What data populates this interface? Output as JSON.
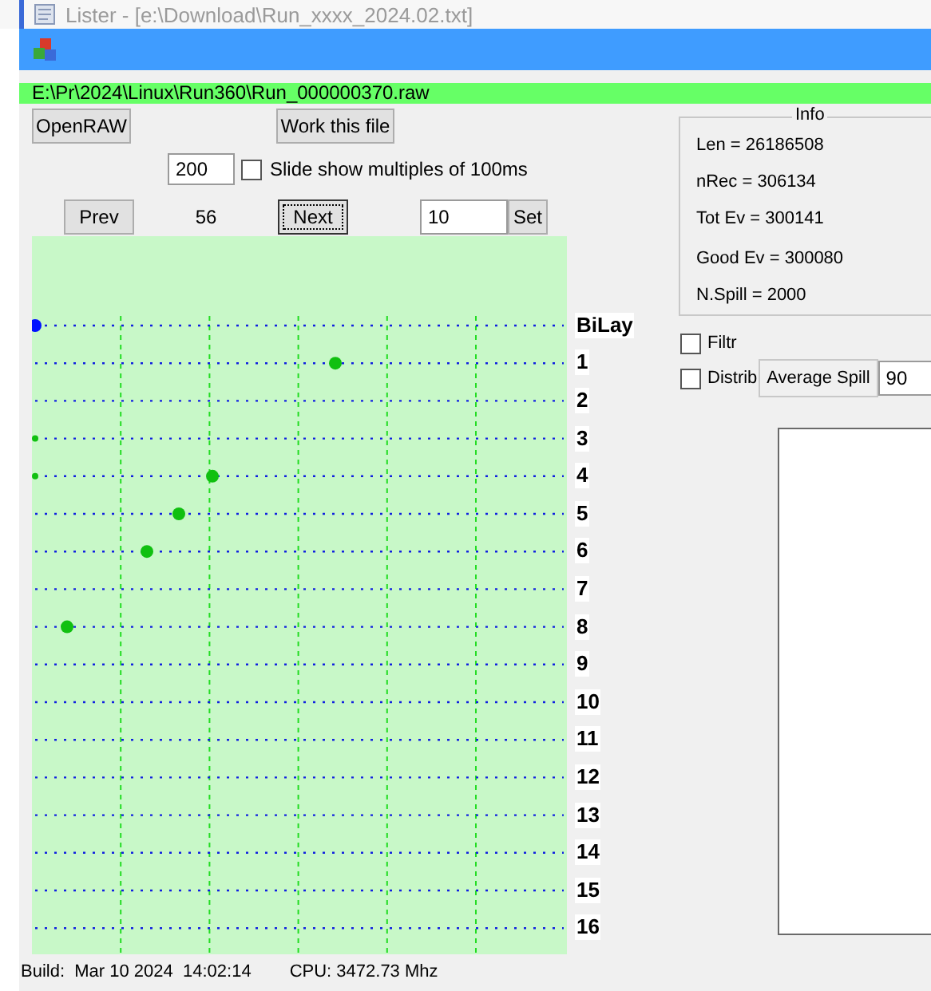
{
  "background_window": {
    "title": "Lister - [e:\\Download\\Run_xxxx_2024.02.txt]"
  },
  "file_path": "E:\\Pr\\2024\\Linux\\Run360\\Run_000000370.raw",
  "open_button": "OpenRAW",
  "work_button": "Work this file",
  "slide": {
    "value": "200",
    "label": "Slide show multiples of 100ms",
    "checked": false
  },
  "nav": {
    "prev": "Prev",
    "current": "56",
    "next": "Next",
    "step_value": "10",
    "set": "Set"
  },
  "layers": [
    "BiLay",
    "1",
    "2",
    "3",
    "4",
    "5",
    "6",
    "7",
    "8",
    "9",
    "10",
    "11",
    "12",
    "13",
    "14",
    "15",
    "16"
  ],
  "info": {
    "title": "Info",
    "groups": [
      [
        "Len = 26186508",
        "nRec = 306134",
        "Tot Ev = 300141"
      ],
      [
        "Good Ev = 300080",
        "N.Spill = 2000"
      ]
    ]
  },
  "filters": [
    {
      "label": "Filtr",
      "checked": false
    },
    {
      "label": "Distrib",
      "checked": false
    }
  ],
  "average_spill": {
    "label": "Average Spill",
    "value": "90"
  },
  "status": {
    "build": "Build:  Mar 10 2024  14:02:14",
    "cpu": "CPU: 3472.73 Mhz"
  }
}
